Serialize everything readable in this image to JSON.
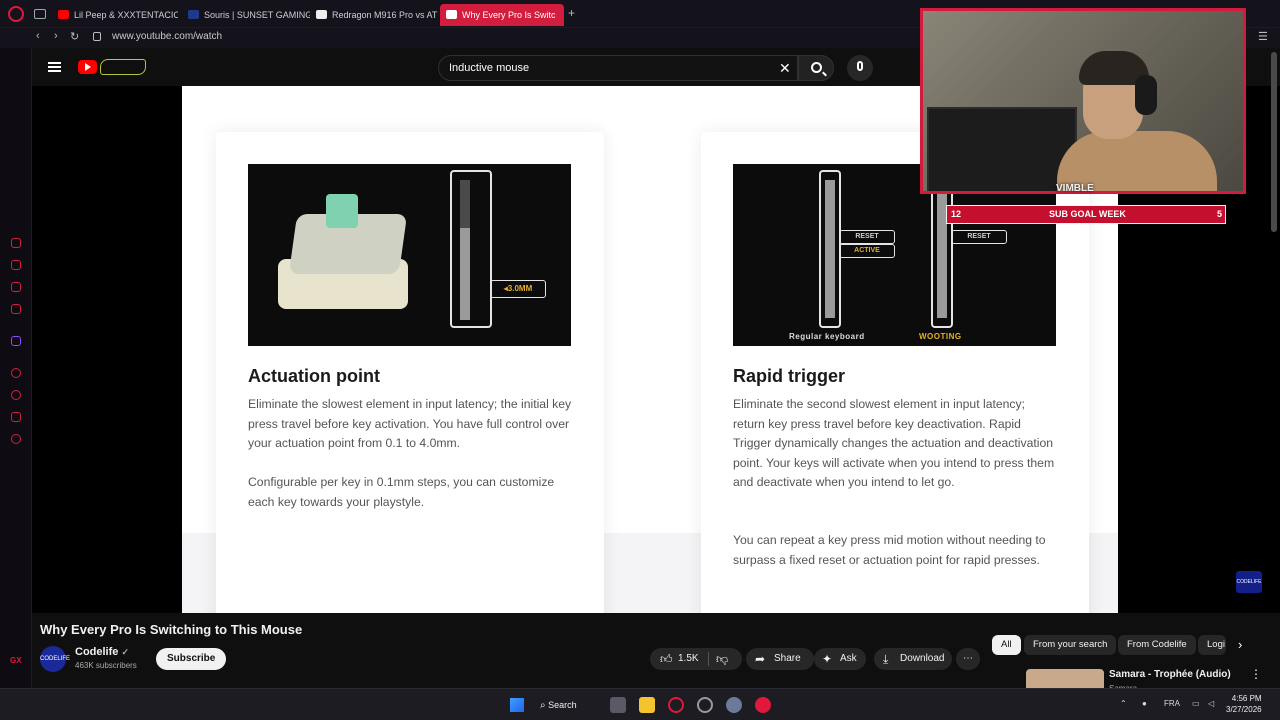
{
  "browser": {
    "tabs": [
      {
        "label": "Lil Peep & XXXTENTACION"
      },
      {
        "label": "Souris | SUNSET GAMING"
      },
      {
        "label": "Redragon M916 Pro vs AT"
      },
      {
        "label": "Why Every Pro Is Switc"
      }
    ],
    "url": "www.youtube.com/watch",
    "sidebar_badge": "GX"
  },
  "youtube": {
    "search_value": "Inductive mouse",
    "video": {
      "cards": [
        {
          "title": "Actuation point",
          "callout": "3.0MM",
          "paragraphs": [
            "Eliminate the slowest element in input latency; the initial key press travel before key activation. You have full control over your actuation point from 0.1 to 4.0mm.",
            "Configurable per key in 0.1mm steps, you can customize each key towards your playstyle."
          ]
        },
        {
          "title": "Rapid trigger",
          "tags": {
            "reset": "RESET",
            "active": "ACTIVE",
            "reset2": "RESET"
          },
          "captions": {
            "left": "Regular keyboard",
            "right": "WOOTING"
          },
          "paragraphs": [
            "Eliminate the second slowest element in input latency; return key press travel before key deactivation. Rapid Trigger dynamically changes the actuation and deactivation point. Your keys will activate when you intend to press them and deactivate when you intend to let go.",
            "You can repeat a key press mid motion without needing to surpass a fixed reset or actuation point for rapid presses."
          ]
        }
      ],
      "overlay": {
        "streamer_name": "VIMBLE",
        "subgoal": {
          "left": "12",
          "label": "SUB GOAL WEEK",
          "right": "5"
        },
        "watermark": "CODELIFE"
      }
    },
    "title": "Why Every Pro Is Switching to This Mouse",
    "channel": {
      "name": "Codelife",
      "subscribers": "463K subscribers",
      "avatar": "CODELIFE"
    },
    "subscribe_label": "Subscribe",
    "actions": {
      "likes": "1.5K",
      "share": "Share",
      "ask": "Ask",
      "download": "Download"
    },
    "chips": [
      "All",
      "From your search",
      "From Codelife",
      "Logi"
    ],
    "recommendation": {
      "title": "Samara - Trophée (Audio)",
      "sub": "Samara"
    }
  },
  "taskbar": {
    "search_label": "Search",
    "lang": "FRA",
    "time": "4:56 PM",
    "date": "3/27/2026"
  },
  "colors": {
    "accent": "#d21d3e",
    "yt_red": "#ff0000",
    "callout_yellow": "#e6b02a"
  }
}
